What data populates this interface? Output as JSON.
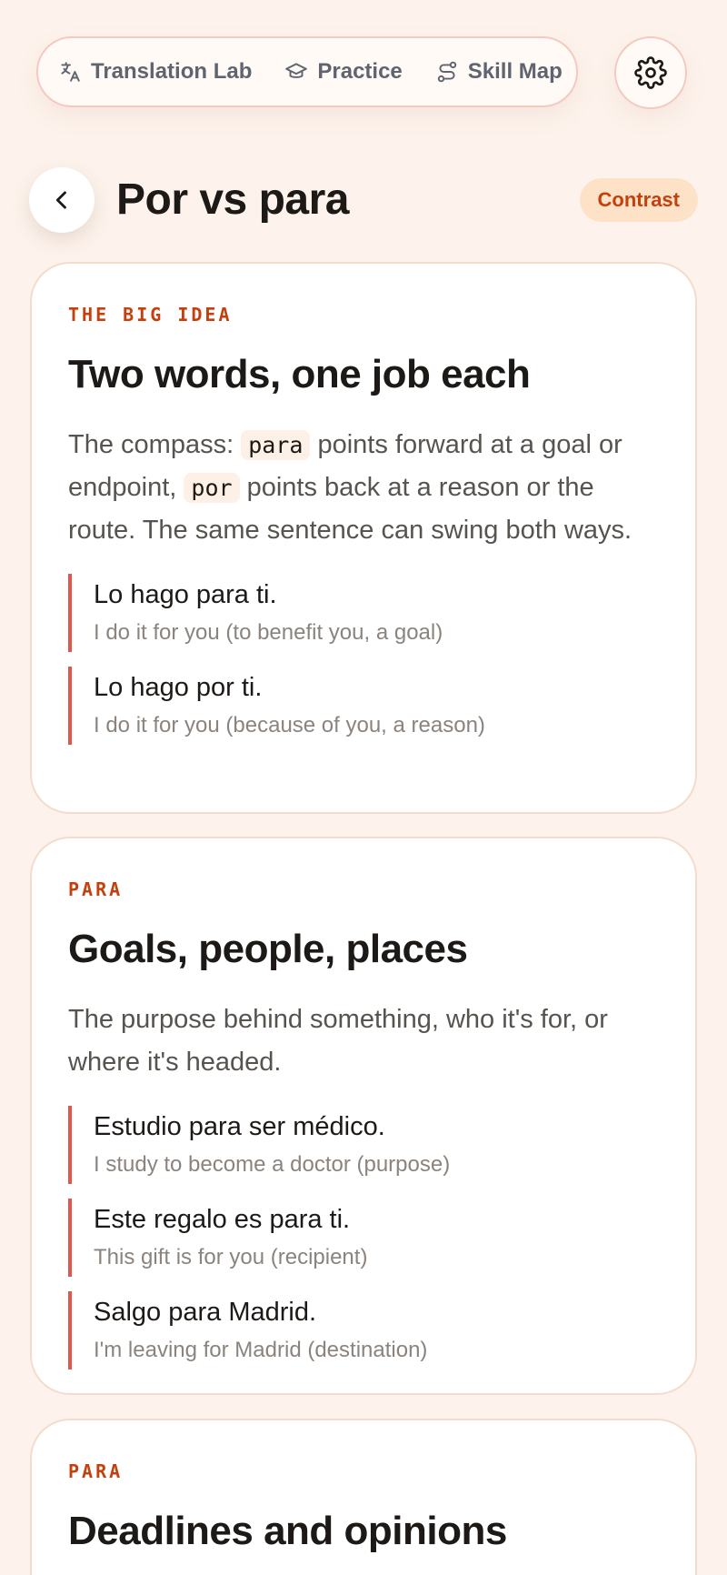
{
  "nav": {
    "items": [
      {
        "label": "Translation Lab",
        "icon": "translate-icon"
      },
      {
        "label": "Practice",
        "icon": "graduation-cap-icon"
      },
      {
        "label": "Skill Map",
        "icon": "route-icon"
      }
    ],
    "settings_icon": "gear-icon"
  },
  "header": {
    "title": "Por vs para",
    "badge": "Contrast"
  },
  "cards": [
    {
      "eyebrow": "THE BIG IDEA",
      "title": "Two words, one job each",
      "body": {
        "p1": "The compass: ",
        "code1": "para",
        "p2": " points forward at a goal or endpoint, ",
        "code2": "por",
        "p3": " points back at a reason or the route. The same sentence can swing both ways."
      },
      "examples": [
        {
          "es": "Lo hago para ti.",
          "en": "I do it for you (to benefit you, a goal)"
        },
        {
          "es": "Lo hago por ti.",
          "en": "I do it for you (because of you, a reason)"
        }
      ]
    },
    {
      "eyebrow": "PARA",
      "title": "Goals, people, places",
      "body": "The purpose behind something, who it's for, or where it's headed.",
      "examples": [
        {
          "es": "Estudio para ser médico.",
          "en": "I study to become a doctor (purpose)"
        },
        {
          "es": "Este regalo es para ti.",
          "en": "This gift is for you (recipient)"
        },
        {
          "es": "Salgo para Madrid.",
          "en": "I'm leaving for Madrid (destination)"
        }
      ]
    },
    {
      "eyebrow": "PARA",
      "title": "Deadlines and opinions"
    }
  ],
  "colors": {
    "background": "#fdf3ec",
    "accent": "#c2410c",
    "example_bar": "#e2574c",
    "badge_bg": "#fde2c8"
  }
}
